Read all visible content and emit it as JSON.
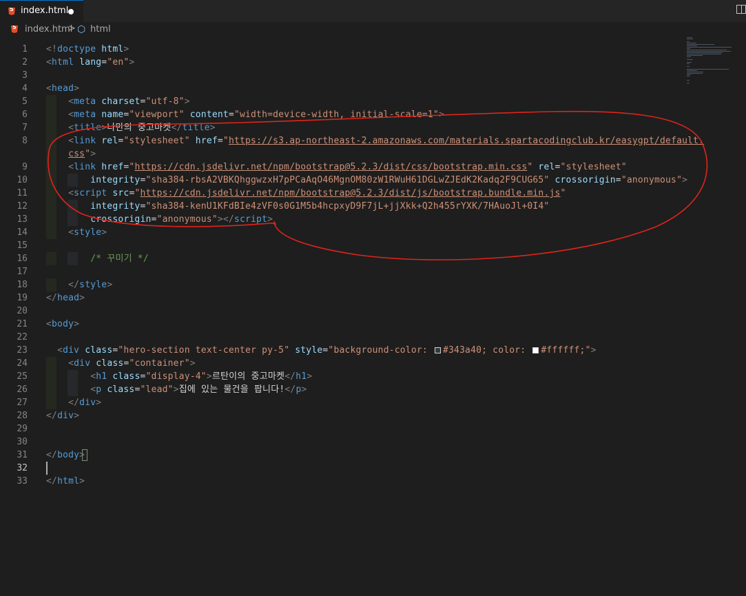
{
  "tab": {
    "filename": "index.html",
    "unsaved": true
  },
  "breadcrumb": {
    "file": "index.html",
    "separator": ">",
    "element": "html"
  },
  "editor": {
    "active_line": 32,
    "lines": [
      {
        "n": "1",
        "tokens": [
          [
            "punc",
            "<!"
          ],
          [
            "tag",
            "doctype"
          ],
          [
            "txt",
            " "
          ],
          [
            "attr",
            "html"
          ],
          [
            "punc",
            ">"
          ]
        ]
      },
      {
        "n": "2",
        "tokens": [
          [
            "punc",
            "<"
          ],
          [
            "tag",
            "html"
          ],
          [
            "txt",
            " "
          ],
          [
            "attr",
            "lang"
          ],
          [
            "txt",
            "="
          ],
          [
            "str",
            "\"en\""
          ],
          [
            "punc",
            ">"
          ]
        ]
      },
      {
        "n": "3",
        "tokens": []
      },
      {
        "n": "4",
        "tokens": [
          [
            "punc",
            "<"
          ],
          [
            "tag",
            "head"
          ],
          [
            "punc",
            ">"
          ]
        ]
      },
      {
        "n": "5",
        "tokens": [
          [
            "txt",
            "    "
          ],
          [
            "punc",
            "<"
          ],
          [
            "tag",
            "meta"
          ],
          [
            "txt",
            " "
          ],
          [
            "attr",
            "charset"
          ],
          [
            "txt",
            "="
          ],
          [
            "str",
            "\"utf-8\""
          ],
          [
            "punc",
            ">"
          ]
        ]
      },
      {
        "n": "6",
        "tokens": [
          [
            "txt",
            "    "
          ],
          [
            "punc",
            "<"
          ],
          [
            "tag",
            "meta"
          ],
          [
            "txt",
            " "
          ],
          [
            "attr",
            "name"
          ],
          [
            "txt",
            "="
          ],
          [
            "str",
            "\"viewport\""
          ],
          [
            "txt",
            " "
          ],
          [
            "attr",
            "content"
          ],
          [
            "txt",
            "="
          ],
          [
            "str",
            "\"width=device-width, initial-scale=1\""
          ],
          [
            "punc",
            ">"
          ]
        ]
      },
      {
        "n": "7",
        "tokens": [
          [
            "txt",
            "    "
          ],
          [
            "punc",
            "<"
          ],
          [
            "tag",
            "title"
          ],
          [
            "punc",
            ">"
          ],
          [
            "txt",
            "나만의 중고마켓"
          ],
          [
            "punc",
            "</"
          ],
          [
            "tag",
            "title"
          ],
          [
            "punc",
            ">"
          ]
        ]
      },
      {
        "n": "8",
        "tokens": [
          [
            "txt",
            "    "
          ],
          [
            "punc",
            "<"
          ],
          [
            "tag",
            "link"
          ],
          [
            "txt",
            " "
          ],
          [
            "attr",
            "rel"
          ],
          [
            "txt",
            "="
          ],
          [
            "str",
            "\"stylesheet\""
          ],
          [
            "txt",
            " "
          ],
          [
            "attr",
            "href"
          ],
          [
            "txt",
            "="
          ],
          [
            "str",
            "\""
          ],
          [
            "url",
            "https://s3.ap-northeast-2.amazonaws.com/materials.spartacodingclub.kr/easygpt/default."
          ]
        ]
      },
      {
        "n": "",
        "tokens": [
          [
            "txt",
            "    "
          ],
          [
            "url",
            "css"
          ],
          [
            "str",
            "\""
          ],
          [
            "punc",
            ">"
          ]
        ]
      },
      {
        "n": "9",
        "tokens": [
          [
            "txt",
            "    "
          ],
          [
            "punc",
            "<"
          ],
          [
            "tag",
            "link"
          ],
          [
            "txt",
            " "
          ],
          [
            "attr",
            "href"
          ],
          [
            "txt",
            "="
          ],
          [
            "str",
            "\""
          ],
          [
            "url",
            "https://cdn.jsdelivr.net/npm/bootstrap@5.2.3/dist/css/bootstrap.min.css"
          ],
          [
            "str",
            "\""
          ],
          [
            "txt",
            " "
          ],
          [
            "attr",
            "rel"
          ],
          [
            "txt",
            "="
          ],
          [
            "str",
            "\"stylesheet\""
          ]
        ]
      },
      {
        "n": "10",
        "tokens": [
          [
            "txt",
            "        "
          ],
          [
            "attr",
            "integrity"
          ],
          [
            "txt",
            "="
          ],
          [
            "str",
            "\"sha384-rbsA2VBKQhggwzxH7pPCaAqO46MgnOM80zW1RWuH61DGLwZJEdK2Kadq2F9CUG65\""
          ],
          [
            "txt",
            " "
          ],
          [
            "attr",
            "crossorigin"
          ],
          [
            "txt",
            "="
          ],
          [
            "str",
            "\"anonymous\""
          ],
          [
            "punc",
            ">"
          ]
        ]
      },
      {
        "n": "11",
        "tokens": [
          [
            "txt",
            "    "
          ],
          [
            "punc",
            "<"
          ],
          [
            "tag",
            "script"
          ],
          [
            "txt",
            " "
          ],
          [
            "attr",
            "src"
          ],
          [
            "txt",
            "="
          ],
          [
            "str",
            "\""
          ],
          [
            "url",
            "https://cdn.jsdelivr.net/npm/bootstrap@5.2.3/dist/js/bootstrap.bundle.min.js"
          ],
          [
            "str",
            "\""
          ]
        ]
      },
      {
        "n": "12",
        "tokens": [
          [
            "txt",
            "        "
          ],
          [
            "attr",
            "integrity"
          ],
          [
            "txt",
            "="
          ],
          [
            "str",
            "\"sha384-kenU1KFdBIe4zVF0s0G1M5b4hcpxyD9F7jL+jjXkk+Q2h455rYXK/7HAuoJl+0I4\""
          ]
        ]
      },
      {
        "n": "13",
        "tokens": [
          [
            "txt",
            "        "
          ],
          [
            "attr",
            "crossorigin"
          ],
          [
            "txt",
            "="
          ],
          [
            "str",
            "\"anonymous\""
          ],
          [
            "punc",
            ">"
          ],
          [
            "punc",
            "</"
          ],
          [
            "tag",
            "script"
          ],
          [
            "punc",
            ">"
          ]
        ]
      },
      {
        "n": "14",
        "tokens": [
          [
            "txt",
            "    "
          ],
          [
            "punc",
            "<"
          ],
          [
            "tag",
            "style"
          ],
          [
            "punc",
            ">"
          ]
        ]
      },
      {
        "n": "15",
        "tokens": []
      },
      {
        "n": "16",
        "tokens": [
          [
            "txt",
            "        "
          ],
          [
            "cmt",
            "/* 꾸미기 */"
          ]
        ]
      },
      {
        "n": "17",
        "tokens": []
      },
      {
        "n": "18",
        "tokens": [
          [
            "txt",
            "    "
          ],
          [
            "punc",
            "</"
          ],
          [
            "tag",
            "style"
          ],
          [
            "punc",
            ">"
          ]
        ]
      },
      {
        "n": "19",
        "tokens": [
          [
            "punc",
            "</"
          ],
          [
            "tag",
            "head"
          ],
          [
            "punc",
            ">"
          ]
        ]
      },
      {
        "n": "20",
        "tokens": []
      },
      {
        "n": "21",
        "tokens": [
          [
            "punc",
            "<"
          ],
          [
            "tag",
            "body"
          ],
          [
            "punc",
            ">"
          ]
        ]
      },
      {
        "n": "22",
        "tokens": []
      },
      {
        "n": "23",
        "tokens": [
          [
            "txt",
            "  "
          ],
          [
            "punc",
            "<"
          ],
          [
            "tag",
            "div"
          ],
          [
            "txt",
            " "
          ],
          [
            "attr",
            "class"
          ],
          [
            "txt",
            "="
          ],
          [
            "str",
            "\"hero-section text-center py-5\""
          ],
          [
            "txt",
            " "
          ],
          [
            "attr",
            "style"
          ],
          [
            "txt",
            "="
          ],
          [
            "str",
            "\"background-color: "
          ],
          [
            "swatch",
            "#343a40"
          ],
          [
            "str",
            "#343a40; color: "
          ],
          [
            "swatch",
            "#ffffff"
          ],
          [
            "str",
            "#ffffff;\""
          ],
          [
            "punc",
            ">"
          ]
        ]
      },
      {
        "n": "24",
        "tokens": [
          [
            "txt",
            "    "
          ],
          [
            "punc",
            "<"
          ],
          [
            "tag",
            "div"
          ],
          [
            "txt",
            " "
          ],
          [
            "attr",
            "class"
          ],
          [
            "txt",
            "="
          ],
          [
            "str",
            "\"container\""
          ],
          [
            "punc",
            ">"
          ]
        ]
      },
      {
        "n": "25",
        "tokens": [
          [
            "txt",
            "        "
          ],
          [
            "punc",
            "<"
          ],
          [
            "tag",
            "h1"
          ],
          [
            "txt",
            " "
          ],
          [
            "attr",
            "class"
          ],
          [
            "txt",
            "="
          ],
          [
            "str",
            "\"display-4\""
          ],
          [
            "punc",
            ">"
          ],
          [
            "txt",
            "르탄이의 중고마켓"
          ],
          [
            "punc",
            "</"
          ],
          [
            "tag",
            "h1"
          ],
          [
            "punc",
            ">"
          ]
        ]
      },
      {
        "n": "26",
        "tokens": [
          [
            "txt",
            "        "
          ],
          [
            "punc",
            "<"
          ],
          [
            "tag",
            "p"
          ],
          [
            "txt",
            " "
          ],
          [
            "attr",
            "class"
          ],
          [
            "txt",
            "="
          ],
          [
            "str",
            "\"lead\""
          ],
          [
            "punc",
            ">"
          ],
          [
            "txt",
            "집에 있는 물건을 팝니다!"
          ],
          [
            "punc",
            "</"
          ],
          [
            "tag",
            "p"
          ],
          [
            "punc",
            ">"
          ]
        ]
      },
      {
        "n": "27",
        "tokens": [
          [
            "txt",
            "    "
          ],
          [
            "punc",
            "</"
          ],
          [
            "tag",
            "div"
          ],
          [
            "punc",
            ">"
          ]
        ]
      },
      {
        "n": "28",
        "tokens": [
          [
            "punc",
            "</"
          ],
          [
            "tag",
            "div"
          ],
          [
            "punc",
            ">"
          ]
        ]
      },
      {
        "n": "29",
        "tokens": []
      },
      {
        "n": "30",
        "tokens": []
      },
      {
        "n": "31",
        "tokens": [
          [
            "punc",
            "</"
          ],
          [
            "tag",
            "body"
          ],
          [
            "punc",
            ">"
          ]
        ]
      },
      {
        "n": "32",
        "tokens": []
      },
      {
        "n": "33",
        "tokens": [
          [
            "punc",
            "</"
          ],
          [
            "tag",
            "html"
          ],
          [
            "punc",
            ">"
          ]
        ]
      }
    ]
  },
  "colors": {
    "editor_bg": "#1e1e1e",
    "annotation_stroke": "#e0241b",
    "tag": "#569cd6",
    "attribute": "#9cdcfe",
    "string": "#ce9178",
    "comment": "#6a9955"
  },
  "icons": {
    "tab_file": "html5-icon",
    "breadcrumb_file": "html5-icon",
    "breadcrumb_element": "symbol-cube-icon",
    "editor_action": "split-editor-icon"
  }
}
